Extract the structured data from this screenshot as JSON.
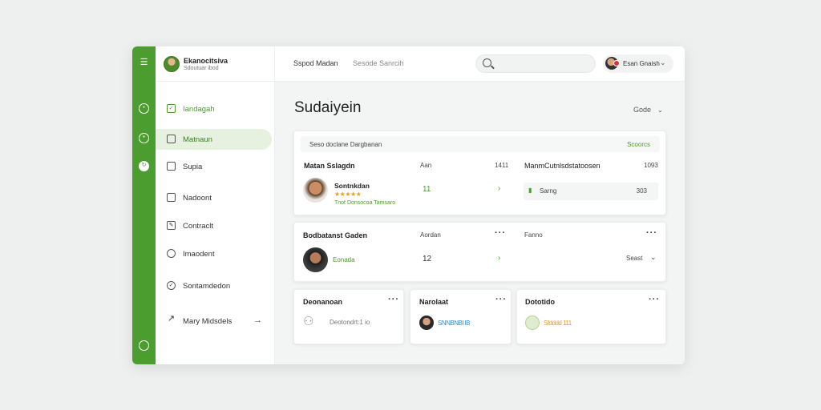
{
  "sidebar_profile": {
    "name": "Ekanocitsiva",
    "subtitle": "Sdoutuar ibod"
  },
  "nav": [
    {
      "label": "Iandagah",
      "icon": "check-square-icon"
    },
    {
      "label": "Matnaun",
      "icon": "square-icon"
    },
    {
      "label": "Supia",
      "icon": "file-icon"
    },
    {
      "label": "Nadoont",
      "icon": "message-icon"
    },
    {
      "label": "Contraclt",
      "icon": "edit-icon"
    },
    {
      "label": "Imaodent",
      "icon": "chat-icon"
    },
    {
      "label": "Sontamdedon",
      "icon": "tag-icon"
    },
    {
      "label": "Mary Midsdels",
      "icon": "share-icon"
    }
  ],
  "topbar": {
    "crumb1": "Sspod Madan",
    "crumb2": "Sesode Sanrcih",
    "user_name": "Esan Gnaish"
  },
  "page": {
    "title": "Sudaiyein",
    "date_label": "Gode"
  },
  "card1": {
    "strip_title": "Seso doclane Dargbanan",
    "strip_action": "Scoorcs",
    "col1_header": "Matan Sslagdn",
    "col2_header": "Aan",
    "col3_header": "1411",
    "col4_header": "ManmCutnlsdstatoosen",
    "col5_header": "1093",
    "person_name": "Sontnkdan",
    "person_meta": "Tnot Donsocoa Tamsaro",
    "value": "11",
    "right_label": "Sarng",
    "right_value": "303"
  },
  "card2": {
    "col1_header": "Bodbatanst Gaden",
    "col2_header": "Aordan",
    "col3_header": "Fanno",
    "person_label": "Eonada",
    "value": "12",
    "right_label": "Seast"
  },
  "card3": {
    "title": "Deonanoan",
    "item_label": "Deotondrt:1 io"
  },
  "card4": {
    "title": "Narolaat",
    "item_label": "SNNBNBI lB"
  },
  "card5": {
    "title": "Dototido",
    "item_label": "Sfdddd 111"
  },
  "colors": {
    "accent": "#4c9d2f",
    "accent_light": "#e6f2df",
    "star": "#e4a11b"
  }
}
